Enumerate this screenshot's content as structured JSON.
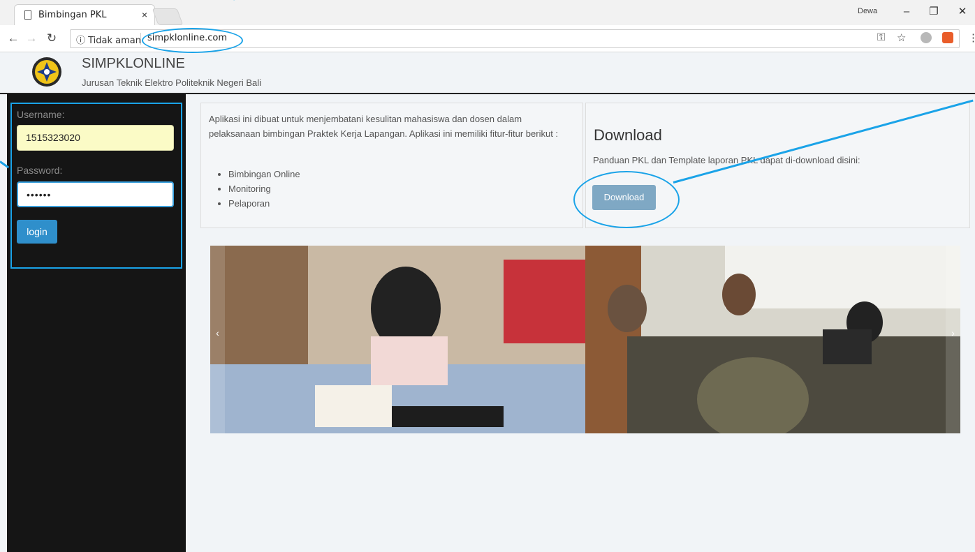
{
  "browser": {
    "tab_title": "Bimbingan PKL",
    "tab_close": "×",
    "profile_name": "Dewa",
    "security_label": "ⓘ Tidak aman",
    "url": "simpklonline.com"
  },
  "site": {
    "title": "SIMPKLONLINE",
    "subtitle": "Jurusan Teknik Elektro Politeknik Negeri Bali"
  },
  "login": {
    "username_label": "Username:",
    "username_value": "1515323020",
    "password_label": "Password:",
    "password_value": "••••••",
    "login_button": "login"
  },
  "intro": {
    "text": "Aplikasi ini dibuat untuk menjembatani kesulitan mahasiswa dan dosen dalam pelaksanaan bimbingan Praktek Kerja Lapangan. Aplikasi ini memiliki fitur-fitur berikut :",
    "features": [
      "Bimbingan Online",
      "Monitoring",
      "Pelaporan"
    ]
  },
  "download": {
    "title": "Download",
    "text": "Panduan PKL dan Template laporan PKL dapat di-download disini:",
    "button": "Download"
  },
  "carousel": {
    "prev": "‹",
    "next": "›"
  },
  "colors": {
    "annotation": "#1aa3e8",
    "sidebar_bg": "#151515",
    "login_button": "#2f8fcb",
    "download_button": "#7fa8c4"
  }
}
